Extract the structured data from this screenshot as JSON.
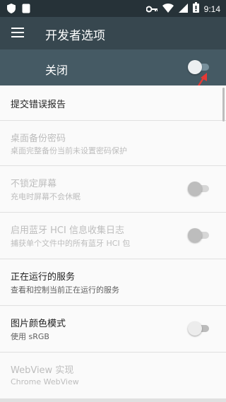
{
  "status_bar": {
    "time": "9:14",
    "icons_left": [
      "shield-icon",
      "sim-square-icon"
    ],
    "icons_right": [
      "key-icon",
      "wifi-icon",
      "signal-icon",
      "battery-icon"
    ]
  },
  "app_bar": {
    "title": "开发者选项",
    "menu_icon": "menu-icon"
  },
  "master_switch": {
    "label": "关闭",
    "state": "off"
  },
  "settings": [
    {
      "title": "提交错误报告",
      "summary": "",
      "enabled": true,
      "toggle": false
    },
    {
      "title": "桌面备份密码",
      "summary": "桌面完整备份当前未设置密码保护",
      "enabled": false,
      "toggle": false
    },
    {
      "title": "不锁定屏幕",
      "summary": "充电时屏幕不会休眠",
      "enabled": false,
      "toggle": true
    },
    {
      "title": "启用蓝牙 HCI 信息收集日志",
      "summary": "捕获单个文件中的所有蓝牙 HCI 包",
      "enabled": false,
      "toggle": true
    },
    {
      "title": "正在运行的服务",
      "summary": "查看和控制当前正在运行的服务",
      "enabled": true,
      "toggle": false
    },
    {
      "title": "图片颜色模式",
      "summary": "使用 sRGB",
      "enabled": true,
      "toggle": true
    },
    {
      "title": "WebView 实现",
      "summary": "Chrome WebView",
      "enabled": false,
      "toggle": false
    }
  ],
  "colors": {
    "status_bar": "#263238",
    "app_bar": "#37474f",
    "master_bar": "#455a64",
    "annotation_arrow": "#e53935"
  }
}
